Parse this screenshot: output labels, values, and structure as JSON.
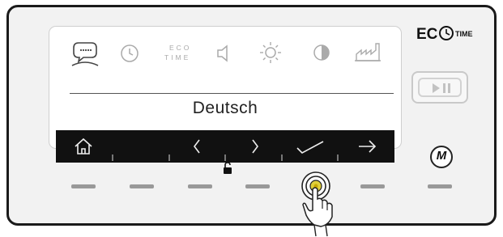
{
  "display": {
    "language_value": "Deutsch",
    "top_icons": [
      {
        "name": "language-speech-bubble-icon",
        "active": true
      },
      {
        "name": "clock-icon",
        "active": false
      },
      {
        "name": "eco-time-icon",
        "active": false,
        "line1": "ECO",
        "line2": "TIME"
      },
      {
        "name": "speaker-volume-icon",
        "active": false
      },
      {
        "name": "brightness-sun-icon",
        "active": false
      },
      {
        "name": "contrast-icon",
        "active": false
      },
      {
        "name": "factory-settings-icon",
        "active": false
      }
    ],
    "nav_bar": [
      {
        "name": "home-icon"
      },
      {
        "name": "blank-slot"
      },
      {
        "name": "chevron-left-icon"
      },
      {
        "name": "chevron-right-icon"
      },
      {
        "name": "checkmark-icon"
      },
      {
        "name": "arrow-right-icon"
      }
    ]
  },
  "brand": {
    "logo_text_main": "EC",
    "logo_text_time": "TIME"
  },
  "buttons": {
    "play_pause_icon": "play-pause-icon",
    "m_label": "M",
    "lock_icon": "unlocked-padlock-icon",
    "pressed_button_icon": "finger-press-icon"
  },
  "colors": {
    "nav_bar_bg": "#111111",
    "screen_bg": "#ffffff",
    "panel_bg": "#f2f2f2",
    "pressed_button_ring": "#c8a800"
  }
}
